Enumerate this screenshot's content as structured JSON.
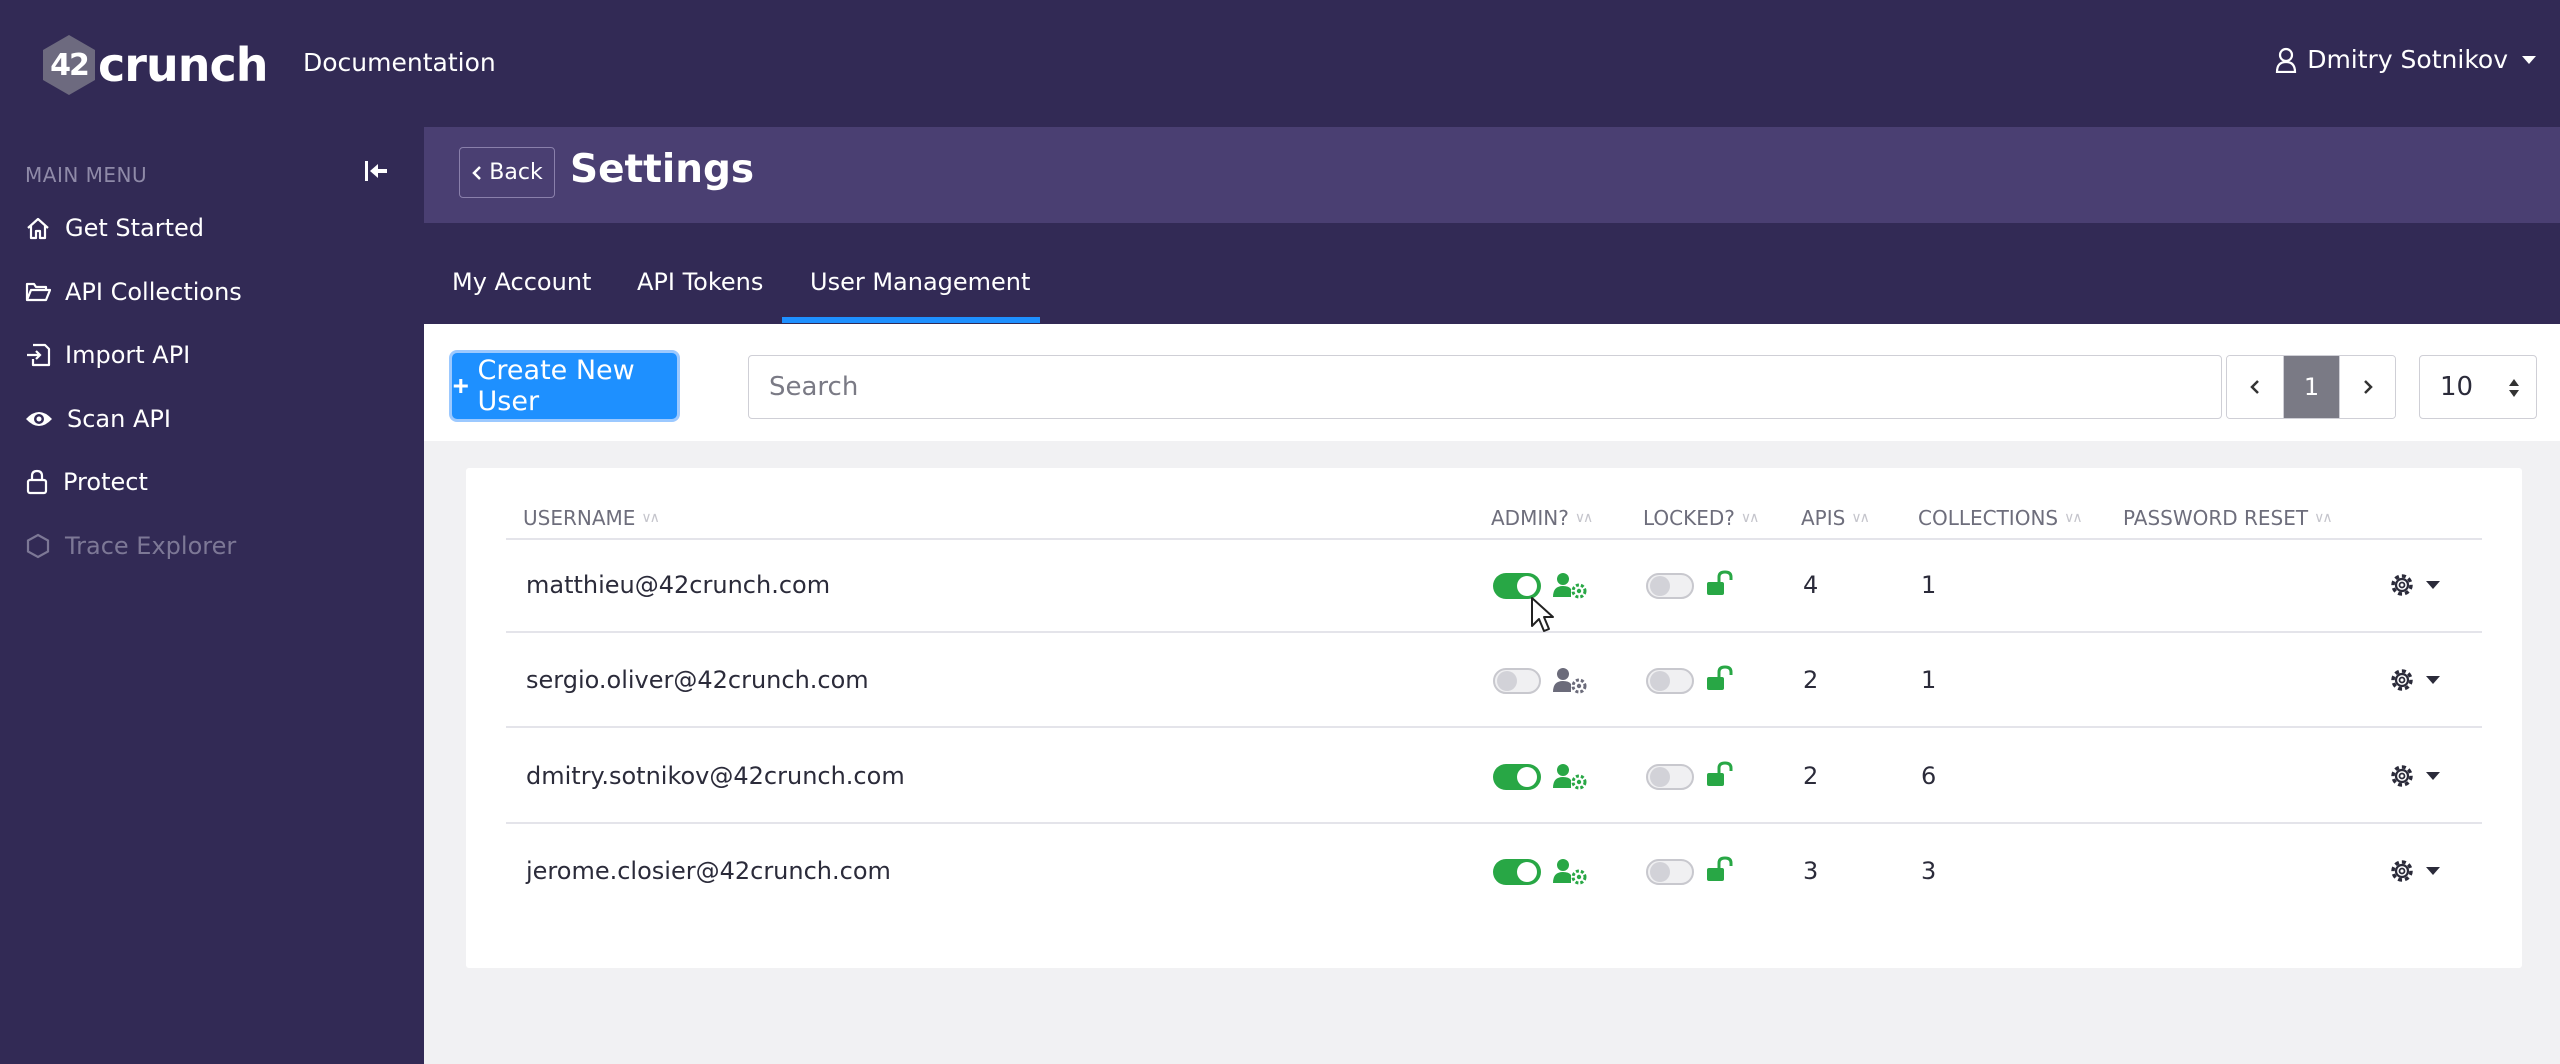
{
  "app": {
    "logo_mark": "42",
    "logo_text": "crunch",
    "top_link": "Documentation",
    "user_name": "Dmitry Sotnikov"
  },
  "sidebar": {
    "heading": "MAIN MENU",
    "items": [
      {
        "label": "Get Started",
        "icon": "home-icon"
      },
      {
        "label": "API Collections",
        "icon": "folder-open-icon"
      },
      {
        "label": "Import API",
        "icon": "import-icon"
      },
      {
        "label": "Scan API",
        "icon": "eye-icon"
      },
      {
        "label": "Protect",
        "icon": "lock-icon"
      },
      {
        "label": "Trace Explorer",
        "icon": "hexagon-icon",
        "disabled": true
      }
    ]
  },
  "header": {
    "back_label": "Back",
    "title": "Settings"
  },
  "tabs": [
    {
      "label": "My Account"
    },
    {
      "label": "API Tokens"
    },
    {
      "label": "User Management",
      "active": true
    }
  ],
  "toolbar": {
    "create_label": "Create New User",
    "search_placeholder": "Search",
    "current_page": "1",
    "page_size": "10"
  },
  "table": {
    "columns": [
      "USERNAME",
      "ADMIN?",
      "LOCKED?",
      "APIS",
      "COLLECTIONS",
      "PASSWORD RESET"
    ],
    "rows": [
      {
        "username": "matthieu@42crunch.com",
        "admin": true,
        "locked": false,
        "apis": "4",
        "collections": "1"
      },
      {
        "username": "sergio.oliver@42crunch.com",
        "admin": false,
        "locked": false,
        "apis": "2",
        "collections": "1"
      },
      {
        "username": "dmitry.sotnikov@42crunch.com",
        "admin": true,
        "locked": false,
        "apis": "2",
        "collections": "6"
      },
      {
        "username": "jerome.closier@42crunch.com",
        "admin": true,
        "locked": false,
        "apis": "3",
        "collections": "3"
      }
    ]
  },
  "colors": {
    "topbar": "#322a55",
    "header_band": "#4a3f72",
    "accent": "#1e90ff",
    "toggle_on": "#28a745",
    "icon_green": "#28a745"
  }
}
